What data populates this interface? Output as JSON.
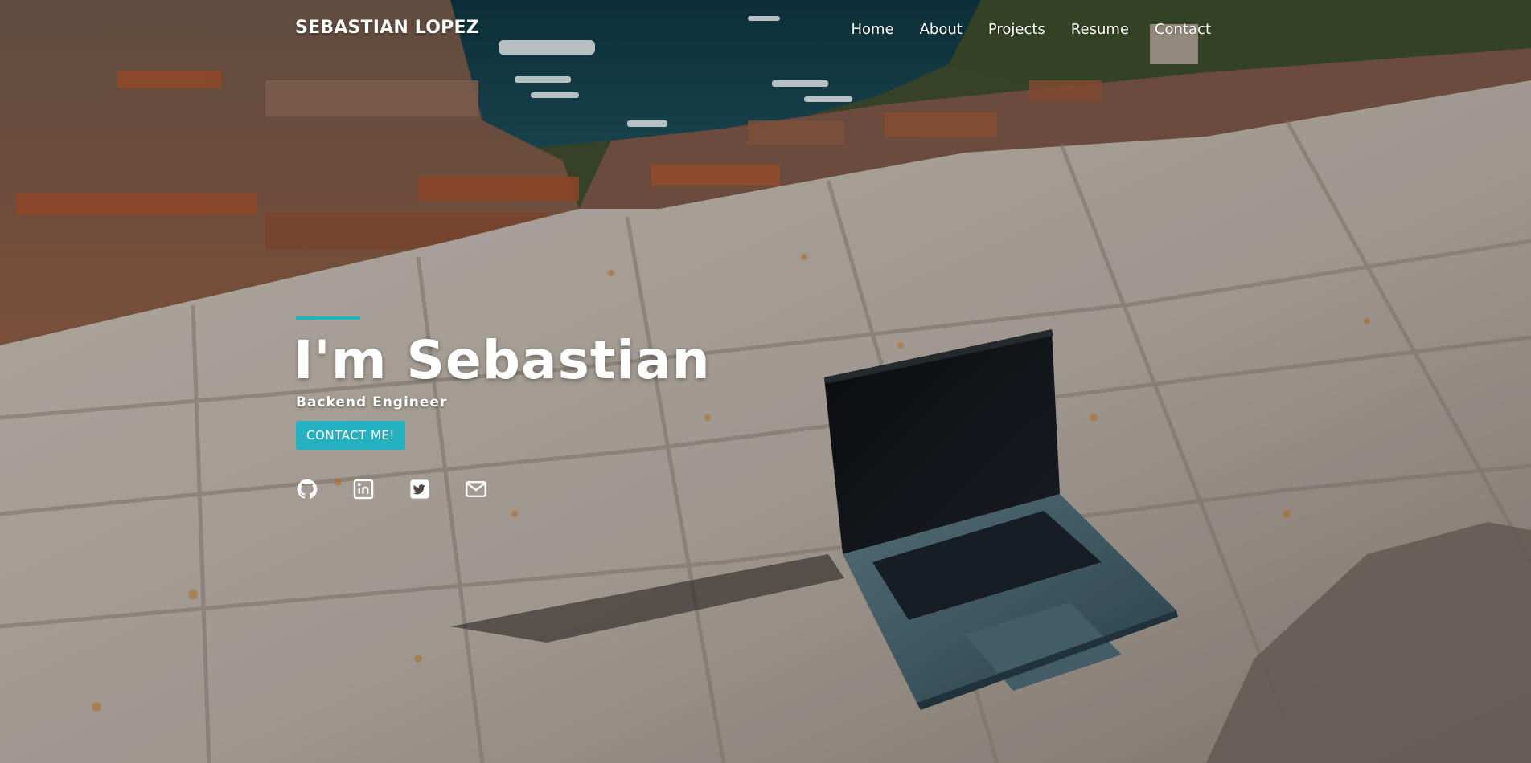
{
  "header": {
    "brand": "SEBASTIAN LOPEZ",
    "nav": [
      "Home",
      "About",
      "Projects",
      "Resume",
      "Contact"
    ]
  },
  "hero": {
    "title": "I'm Sebastian",
    "subtitle": "Backend Engineer",
    "cta_label": "CONTACT ME!",
    "background_icon": "laptop-on-stone-wall-photo"
  },
  "social": [
    {
      "icon": "github-icon"
    },
    {
      "icon": "linkedin-icon"
    },
    {
      "icon": "twitter-icon"
    },
    {
      "icon": "mail-icon"
    }
  ],
  "colors": {
    "accent": "#25b0bf",
    "text": "#ffffff",
    "water": "#143b47",
    "stone": "#b9b0a6"
  }
}
